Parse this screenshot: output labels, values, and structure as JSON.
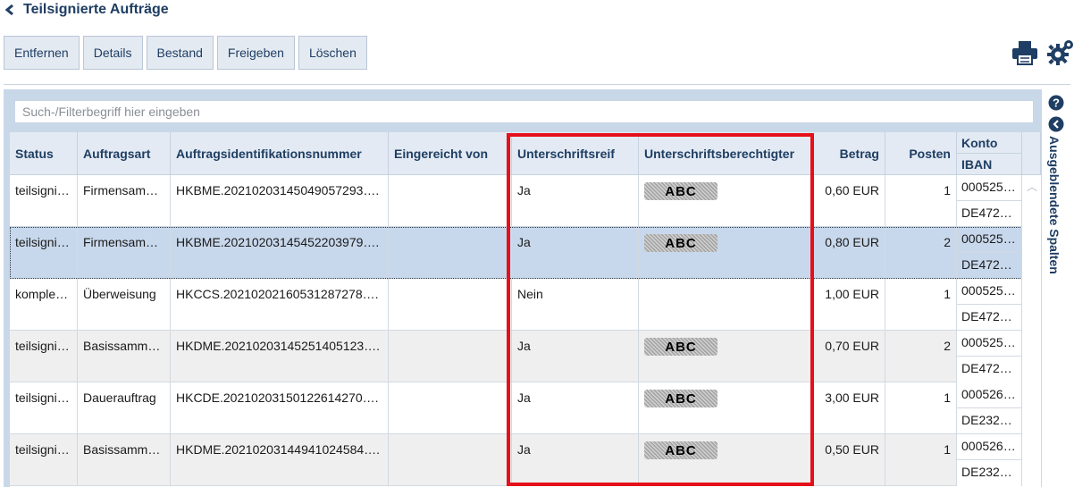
{
  "title": "Teilsignierte Aufträge",
  "toolbar": [
    "Entfernen",
    "Details",
    "Bestand",
    "Freigeben",
    "Löschen"
  ],
  "filter_placeholder": "Such-/Filterbegriff hier eingeben",
  "columns": {
    "status": "Status",
    "art": "Auftragsart",
    "id": "Auftragsidentifikationsnummer",
    "von": "Eingereicht von",
    "reif": "Unterschriftsreif",
    "berechtigt": "Unterschriftsberechtigter",
    "betrag": "Betrag",
    "posten": "Posten",
    "konto": "Konto",
    "iban": "IBAN"
  },
  "rows": [
    {
      "status": "teilsigniert",
      "art": "Firmensam…",
      "id": "HKBME.2021020314504905729­3….",
      "von": "",
      "reif": "Ja",
      "signature": "ABC",
      "betrag": "0,60 EUR",
      "posten": "1",
      "konto": "000525…",
      "iban": "DE472…"
    },
    {
      "status": "teilsigniert",
      "art": "Firmensam…",
      "id": "HKBME.20210203145452203979….",
      "von": "",
      "reif": "Ja",
      "signature": "ABC",
      "betrag": "0,80 EUR",
      "posten": "2",
      "konto": "000525…",
      "iban": "DE472…"
    },
    {
      "status": "komplet…",
      "art": "Überweisung",
      "id": "HKCCS.20210202160531287278….",
      "von": "",
      "reif": "Nein",
      "signature": "",
      "betrag": "1,00 EUR",
      "posten": "1",
      "konto": "000525…",
      "iban": "DE472…"
    },
    {
      "status": "teilsigniert",
      "art": "Basissamme…",
      "id": "HKDME.20210203145251405123….",
      "von": "",
      "reif": "Ja",
      "signature": "ABC",
      "betrag": "0,70 EUR",
      "posten": "2",
      "konto": "000525…",
      "iban": "DE472…"
    },
    {
      "status": "teilsigniert",
      "art": "Dauerauftrag",
      "id": "HKCDE.20210203150122614270….",
      "von": "",
      "reif": "Ja",
      "signature": "ABC",
      "betrag": "3,00 EUR",
      "posten": "1",
      "konto": "000526…",
      "iban": "DE232…"
    },
    {
      "status": "teilsigniert",
      "art": "Basissamme…",
      "id": "HKDME.20210203144941024584….",
      "von": "",
      "reif": "Ja",
      "signature": "ABC",
      "betrag": "0,50 EUR",
      "posten": "1",
      "konto": "000526…",
      "iban": "DE232…"
    }
  ],
  "side_label": "Ausgeblendete Spalten",
  "icons": [
    "back-icon",
    "print-icon",
    "gear-icon",
    "help-icon",
    "chevron-left-icon"
  ],
  "colors": {
    "accent": "#1f3e63",
    "highlight_box": "#e5101a",
    "selected_row": "#c8d8ec",
    "header_bg": "#e3eaf3"
  }
}
